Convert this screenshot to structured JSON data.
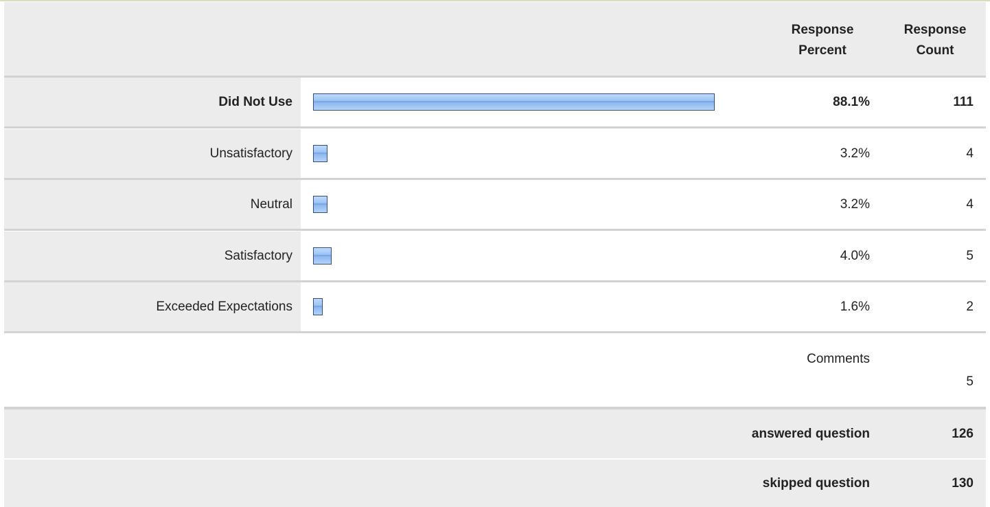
{
  "header": {
    "percent_label_1": "Response",
    "percent_label_2": "Percent",
    "count_label_1": "Response",
    "count_label_2": "Count"
  },
  "chart_data": {
    "type": "bar",
    "categories": [
      "Did Not Use",
      "Unsatisfactory",
      "Neutral",
      "Satisfactory",
      "Exceeded Expectations"
    ],
    "values": [
      88.1,
      3.2,
      3.2,
      4.0,
      1.6
    ],
    "percent_labels": [
      "88.1%",
      "3.2%",
      "3.2%",
      "4.0%",
      "1.6%"
    ],
    "counts": [
      "111",
      "4",
      "4",
      "5",
      "2"
    ],
    "highlighted_category": "Did Not Use",
    "bar_color": "#9fc5f5",
    "bar_border": "#334d77"
  },
  "comments": {
    "label": "Comments",
    "count": "5"
  },
  "summary": {
    "answered_label": "answered question",
    "answered_count": "126",
    "skipped_label": "skipped question",
    "skipped_count": "130"
  }
}
